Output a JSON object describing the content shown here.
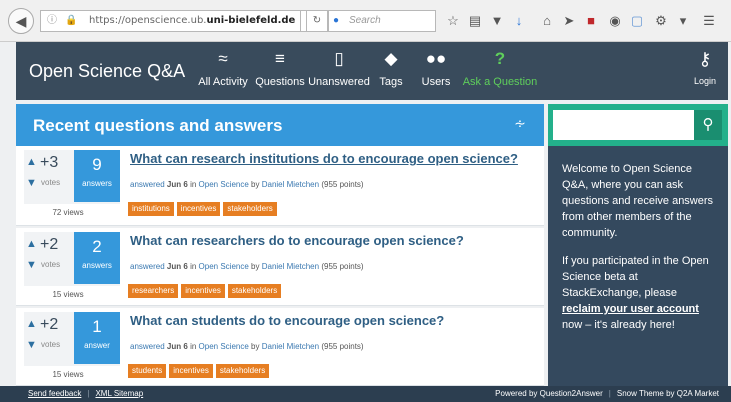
{
  "browser": {
    "url_prefix": "https://openscience.ub.",
    "url_domain": "uni-bielefeld.de",
    "search_placeholder": "Search"
  },
  "site": {
    "brand": "Open Science Q&A",
    "nav": [
      {
        "label": "All Activity",
        "icon": "activity-icon"
      },
      {
        "label": "Questions",
        "icon": "list-icon"
      },
      {
        "label": "Unanswered",
        "icon": "chat-icon"
      },
      {
        "label": "Tags",
        "icon": "tag-icon"
      },
      {
        "label": "Users",
        "icon": "users-icon"
      },
      {
        "label": "Ask a Question",
        "icon": "question-icon"
      }
    ],
    "login_label": "Login"
  },
  "main": {
    "heading": "Recent questions and answers",
    "questions": [
      {
        "votes": "+3",
        "votes_label": "votes",
        "answers": "9",
        "answers_label": "answers",
        "views": "72 views",
        "title": "What can research institutions do to encourage open science?",
        "meta_action": "answered",
        "meta_date": "Jun 6",
        "meta_in": "in",
        "meta_category": "Open Science",
        "meta_by": "by",
        "meta_user": "Daniel Mietchen",
        "meta_points": "(955 points)",
        "tags": [
          "institutions",
          "incentives",
          "stakeholders"
        ]
      },
      {
        "votes": "+2",
        "votes_label": "votes",
        "answers": "2",
        "answers_label": "answers",
        "views": "15 views",
        "title": "What can researchers do to encourage open science?",
        "meta_action": "answered",
        "meta_date": "Jun 6",
        "meta_in": "in",
        "meta_category": "Open Science",
        "meta_by": "by",
        "meta_user": "Daniel Mietchen",
        "meta_points": "(955 points)",
        "tags": [
          "researchers",
          "incentives",
          "stakeholders"
        ]
      },
      {
        "votes": "+2",
        "votes_label": "votes",
        "answers": "1",
        "answers_label": "answer",
        "views": "15 views",
        "title": "What can students do to encourage open science?",
        "meta_action": "answered",
        "meta_date": "Jun 6",
        "meta_in": "in",
        "meta_category": "Open Science",
        "meta_by": "by",
        "meta_user": "Daniel Mietchen",
        "meta_points": "(955 points)",
        "tags": [
          "students",
          "incentives",
          "stakeholders"
        ]
      }
    ]
  },
  "sidebar": {
    "welcome": "Welcome to Open Science Q&A, where you can ask questions and receive answers from other members of the community.",
    "beta_pre": "If you participated in the Open Science beta at StackExchange, please",
    "reclaim_link": "reclaim your user account",
    "beta_post": "now – it's already here!"
  },
  "footer": {
    "feedback": "Send feedback",
    "sitemap": "XML Sitemap",
    "powered": "Powered by Question2Answer",
    "theme": "Snow Theme by Q2A Market"
  },
  "colors": {
    "nav_bg": "#394b5c",
    "hero_bg": "#3598db",
    "search_bg": "#23b08b",
    "tag_bg": "#e67e22",
    "ask_green": "#5fcf5b"
  }
}
